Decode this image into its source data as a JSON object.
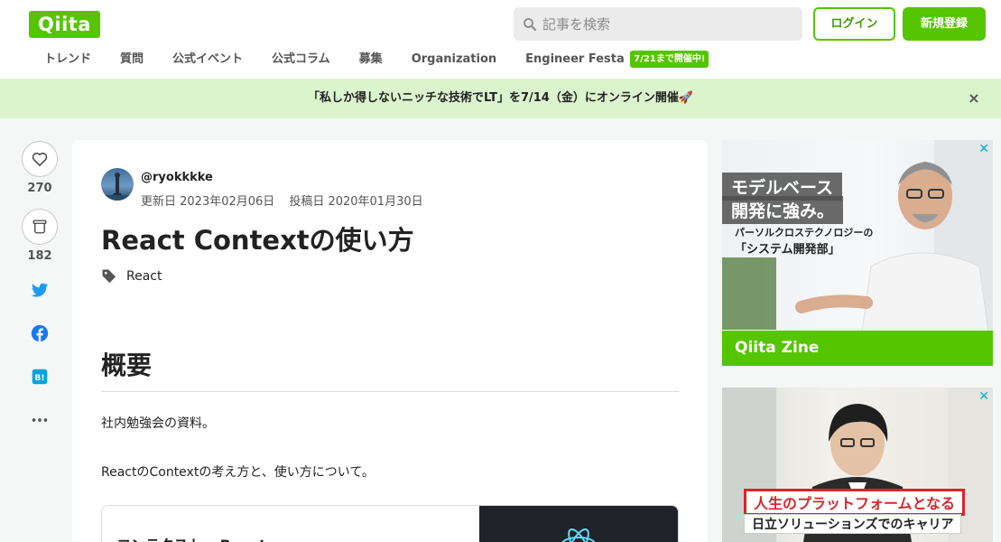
{
  "header": {
    "logo": "Qiita",
    "search_placeholder": "記事を検索",
    "login": "ログイン",
    "signup": "新規登録"
  },
  "nav": {
    "items": [
      "トレンド",
      "質問",
      "公式イベント",
      "公式コラム",
      "募集",
      "Organization",
      "Engineer Festa"
    ],
    "badge": "7/21まで開催中!"
  },
  "banner": {
    "text": "「私しか得しないニッチな技術でLT」を7/14（金）にオンライン開催🚀",
    "close": "×"
  },
  "side": {
    "likes": "270",
    "stocks": "182"
  },
  "article": {
    "username": "@ryokkkke",
    "updated": "更新日 2023年02月06日",
    "posted": "投稿日 2020年01月30日",
    "title": "React Contextの使い方",
    "tag": "React",
    "h1": "概要",
    "para1": "社内勉強会の資料。",
    "para2": "ReactのContextの考え方と、使い方について。",
    "link_card_title": "コンテクスト – React"
  },
  "ads": {
    "ad1_line1": "モデルベース",
    "ad1_line2": "開発に強み。",
    "ad1_sub1": "パーソルクロステクノロジーの",
    "ad1_sub2": "「システム開発部」",
    "ad1_footer": "Qiita Zine",
    "ad2_line1": "人生のプラットフォームとなる",
    "ad2_line2": "日立ソリューションズでのキャリア",
    "close": "✕"
  }
}
